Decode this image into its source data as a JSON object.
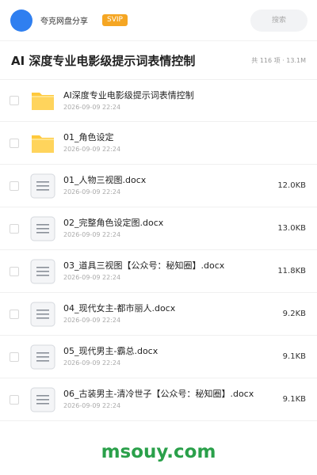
{
  "header": {
    "brand": "夸克网盘分享",
    "badge": "SVIP",
    "search_placeholder": "搜索"
  },
  "folder": {
    "title": "AI 深度专业电影级提示词表情控制",
    "meta": "共 116 项 · 13.1M"
  },
  "files": [
    {
      "type": "folder",
      "name": "AI深度专业电影级提示词表情控制",
      "date": "2026-09-09 22:24",
      "size": ""
    },
    {
      "type": "folder",
      "name": "01_角色设定",
      "date": "2026-09-09 22:24",
      "size": ""
    },
    {
      "type": "document",
      "name": "01_人物三视图.docx",
      "date": "2026-09-09 22:24",
      "size": "12.0KB"
    },
    {
      "type": "document",
      "name": "02_完整角色设定图.docx",
      "date": "2026-09-09 22:24",
      "size": "13.0KB"
    },
    {
      "type": "document",
      "name": "03_道具三视图【公众号：秘知圈】.docx",
      "date": "2026-09-09 22:24",
      "size": "11.8KB"
    },
    {
      "type": "document",
      "name": "04_现代女主-都市丽人.docx",
      "date": "2026-09-09 22:24",
      "size": "9.2KB"
    },
    {
      "type": "document",
      "name": "05_现代男主-霸总.docx",
      "date": "2026-09-09 22:24",
      "size": "9.1KB"
    },
    {
      "type": "document",
      "name": "06_古装男主-清冷世子【公众号：秘知圈】.docx",
      "date": "2026-09-09 22:24",
      "size": "9.1KB"
    }
  ],
  "watermark": "msouy.com",
  "colors": {
    "avatar": "#2f7ff0",
    "badge": "#f5a623",
    "folder": "#ffc93c",
    "watermark": "#2aa04a"
  },
  "icons": {
    "folder": "folder-icon",
    "document": "document-icon"
  }
}
